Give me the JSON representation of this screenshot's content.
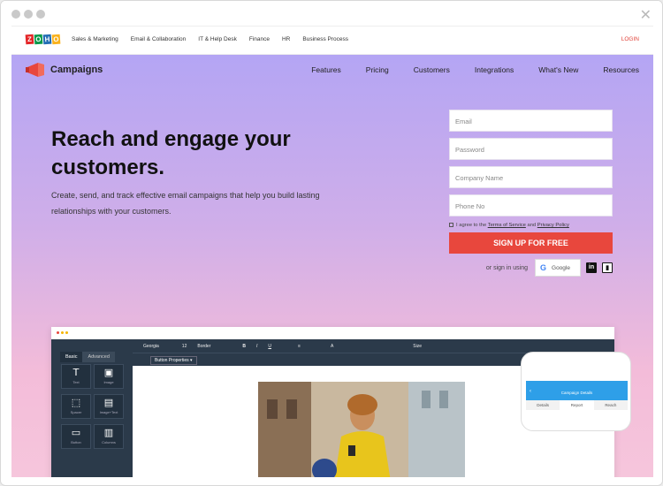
{
  "zoho_bar": {
    "logo_letters": [
      "Z",
      "O",
      "H",
      "O"
    ],
    "logo_colors": [
      "#e42527",
      "#089949",
      "#226db4",
      "#f9b21d"
    ],
    "links": [
      "Sales & Marketing",
      "Email & Collaboration",
      "IT & Help Desk",
      "Finance",
      "HR",
      "Business Process"
    ],
    "login": "LOGIN"
  },
  "header": {
    "brand": "Campaigns",
    "nav": [
      "Features",
      "Pricing",
      "Customers",
      "Integrations",
      "What's New",
      "Resources"
    ]
  },
  "hero": {
    "headline": "Reach and engage your customers.",
    "subtext": "Create, send, and track effective email campaigns that help you build lasting relationships with your customers."
  },
  "form": {
    "email_placeholder": "Email",
    "password_placeholder": "Password",
    "company_placeholder": "Company Name",
    "phone_placeholder": "Phone No",
    "agree_prefix": "I agree to the",
    "terms": "Terms of Service",
    "and": "and",
    "privacy": "Privacy Policy",
    "signup": "SIGN UP FOR FREE",
    "or_sign_in": "or sign in using",
    "google": "Google",
    "linkedin_glyph": "in"
  },
  "editor": {
    "tabs": [
      "Basic",
      "Advanced"
    ],
    "tools": [
      {
        "glyph": "T",
        "label": "Text"
      },
      {
        "glyph": "▣",
        "label": "Image"
      },
      {
        "glyph": "⬚",
        "label": "Spacer"
      },
      {
        "glyph": "▤",
        "label": "Image+Text"
      },
      {
        "glyph": "▭",
        "label": "Button"
      },
      {
        "glyph": "▥",
        "label": "Columns"
      }
    ],
    "toolbar": [
      "Georgia",
      "12",
      "Border",
      "B",
      "I",
      "U",
      "≡",
      "A",
      "Size"
    ],
    "button_properties": "Button Properties ▾"
  },
  "phone": {
    "title": "Campaign Details",
    "tabs": [
      "Details",
      "Report",
      "Reach"
    ]
  },
  "colors": {
    "accent": "#e8473d",
    "hero_top": "#b4a5f4",
    "hero_bottom": "#f6c6dc",
    "editor_dark": "#2b3a4a",
    "phone_blue": "#2e9fe8"
  }
}
